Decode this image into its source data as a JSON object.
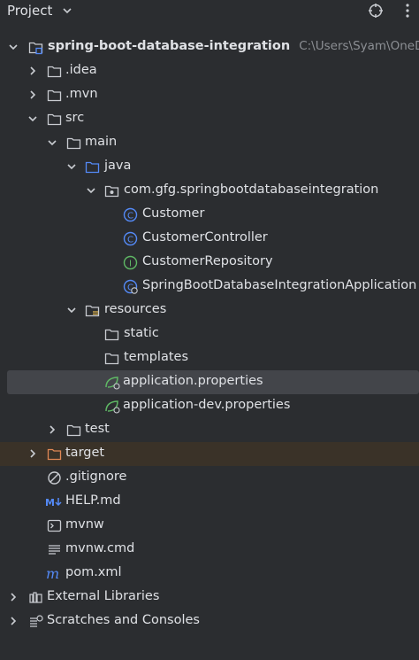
{
  "header": {
    "title": "Project"
  },
  "tree": {
    "root": {
      "label": "spring-boot-database-integration",
      "path": "C:\\Users\\Syam\\OneD"
    },
    "idea": "idea",
    "mvn": "mvn",
    "src": "src",
    "main": "main",
    "java": "java",
    "package": "com.gfg.springbootdatabaseintegration",
    "customer": "Customer",
    "customer_controller": "CustomerController",
    "customer_repository": "CustomerRepository",
    "application": "SpringBootDatabaseIntegrationApplication",
    "resources": "resources",
    "static": "static",
    "templates": "templates",
    "app_properties": "application.properties",
    "app_dev_properties": "application-dev.properties",
    "test": "test",
    "target": "target",
    "gitignore": ".gitignore",
    "help": "HELP.md",
    "mvnw": "mvnw",
    "mvnw_cmd": "mvnw.cmd",
    "pom": "pom.xml",
    "external_libraries": "External Libraries",
    "scratches": "Scratches and Consoles"
  },
  "colors": {
    "background": "#2b2d30",
    "selected": "#43454a",
    "excluded": "#3a3228",
    "class_icon": "#548af7",
    "interface_icon": "#5fb865",
    "spring_icon": "#5fb865",
    "target_folder": "#e08855"
  }
}
